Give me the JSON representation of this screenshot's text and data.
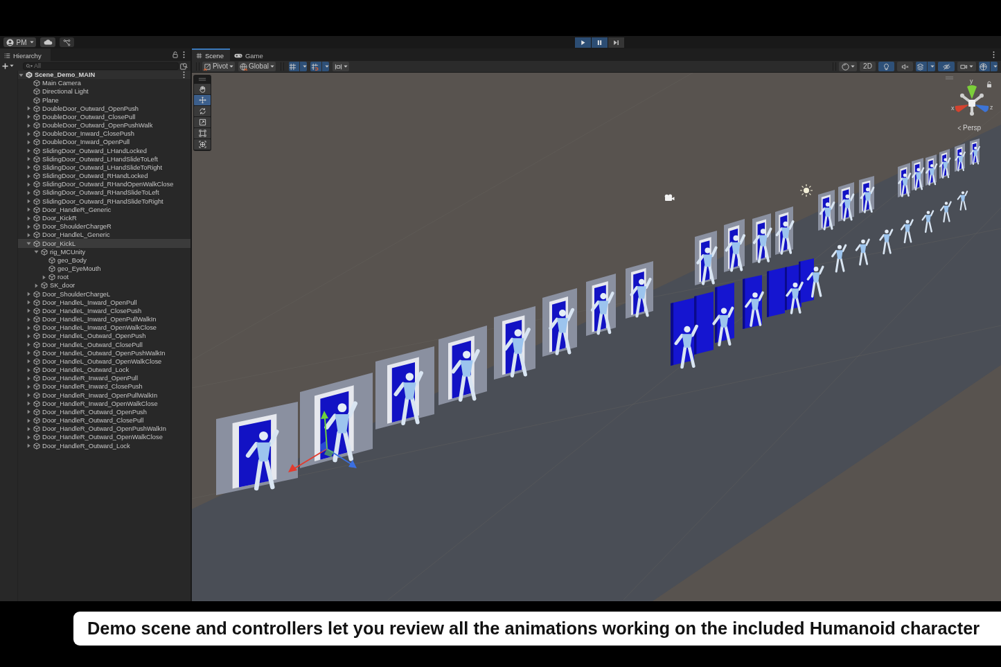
{
  "toolbar": {
    "account": {
      "label": "PM"
    },
    "play_controls": [
      {
        "kind": "play",
        "selected": true
      },
      {
        "kind": "pause",
        "selected": true
      },
      {
        "kind": "step",
        "selected": false
      }
    ]
  },
  "hierarchy": {
    "tab": {
      "label": "Hierarchy"
    },
    "search": {
      "placeholder": "All"
    },
    "scene": {
      "name": "Scene_Demo_MAIN",
      "expanded": true,
      "selected": false,
      "children": [
        {
          "name": "Main Camera",
          "selected": false
        },
        {
          "name": "Directional Light",
          "selected": false
        },
        {
          "name": "Plane",
          "selected": false
        },
        {
          "name": "DoubleDoor_Outward_OpenPush",
          "expanded": false,
          "selected": false
        },
        {
          "name": "DoubleDoor_Outward_ClosePull",
          "expanded": false,
          "selected": false
        },
        {
          "name": "DoubleDoor_Outward_OpenPushWalk",
          "expanded": false,
          "selected": false
        },
        {
          "name": "DoubleDoor_Inward_ClosePush",
          "expanded": false,
          "selected": false
        },
        {
          "name": "DoubleDoor_Inward_OpenPull",
          "expanded": false,
          "selected": false
        },
        {
          "name": "SlidingDoor_Outward_LHandLocked",
          "expanded": false,
          "selected": false
        },
        {
          "name": "SlidingDoor_Outward_LHandSlideToLeft",
          "expanded": false,
          "selected": false
        },
        {
          "name": "SlidingDoor_Outward_LHandSlideToRight",
          "expanded": false,
          "selected": false
        },
        {
          "name": "SlidingDoor_Outward_RHandLocked",
          "expanded": false,
          "selected": false
        },
        {
          "name": "SlidingDoor_Outward_RHandOpenWalkClose",
          "expanded": false,
          "selected": false
        },
        {
          "name": "SlidingDoor_Outward_RHandSlideToLeft",
          "expanded": false,
          "selected": false
        },
        {
          "name": "SlidingDoor_Outward_RHandSlideToRight",
          "expanded": false,
          "selected": false
        },
        {
          "name": "Door_HandleR_Generic",
          "expanded": false,
          "selected": false
        },
        {
          "name": "Door_KickR",
          "expanded": false,
          "selected": false
        },
        {
          "name": "Door_ShoulderChargeR",
          "expanded": false,
          "selected": false
        },
        {
          "name": "Door_HandleL_Generic",
          "expanded": false,
          "selected": false
        },
        {
          "name": "Door_KickL",
          "expanded": true,
          "selected": true,
          "children": [
            {
              "name": "rig_MCUnity",
              "expanded": true,
              "selected": false,
              "children": [
                {
                  "name": "geo_Body",
                  "selected": false
                },
                {
                  "name": "geo_EyeMouth",
                  "selected": false
                },
                {
                  "name": "root",
                  "expanded": false,
                  "selected": false
                }
              ]
            },
            {
              "name": "SK_door",
              "expanded": false,
              "selected": false
            }
          ]
        },
        {
          "name": "Door_ShoulderChargeL",
          "expanded": false,
          "selected": false
        },
        {
          "name": "Door_HandleL_Inward_OpenPull",
          "expanded": false,
          "selected": false
        },
        {
          "name": "Door_HandleL_Inward_ClosePush",
          "expanded": false,
          "selected": false
        },
        {
          "name": "Door_HandleL_Inward_OpenPullWalkIn",
          "expanded": false,
          "selected": false
        },
        {
          "name": "Door_HandleL_Inward_OpenWalkClose",
          "expanded": false,
          "selected": false
        },
        {
          "name": "Door_HandleL_Outward_OpenPush",
          "expanded": false,
          "selected": false
        },
        {
          "name": "Door_HandleL_Outward_ClosePull",
          "expanded": false,
          "selected": false
        },
        {
          "name": "Door_HandleL_Outward_OpenPushWalkIn",
          "expanded": false,
          "selected": false
        },
        {
          "name": "Door_HandleL_Outward_OpenWalkClose",
          "expanded": false,
          "selected": false
        },
        {
          "name": "Door_HandleL_Outward_Lock",
          "expanded": false,
          "selected": false
        },
        {
          "name": "Door_HandleR_Inward_OpenPull",
          "expanded": false,
          "selected": false
        },
        {
          "name": "Door_HandleR_Inward_ClosePush",
          "expanded": false,
          "selected": false
        },
        {
          "name": "Door_HandleR_Inward_OpenPullWalkIn",
          "expanded": false,
          "selected": false
        },
        {
          "name": "Door_HandleR_Inward_OpenWalkClose",
          "expanded": false,
          "selected": false
        },
        {
          "name": "Door_HandleR_Outward_OpenPush",
          "expanded": false,
          "selected": false
        },
        {
          "name": "Door_HandleR_Outward_ClosePull",
          "expanded": false,
          "selected": false
        },
        {
          "name": "Door_HandleR_Outward_OpenPushWalkIn",
          "expanded": false,
          "selected": false
        },
        {
          "name": "Door_HandleR_Outward_OpenWalkClose",
          "expanded": false,
          "selected": false
        },
        {
          "name": "Door_HandleR_Outward_Lock",
          "expanded": false,
          "selected": false
        }
      ]
    }
  },
  "scene_panel": {
    "tabs": [
      {
        "label": "Scene",
        "selected": true
      },
      {
        "label": "Game",
        "selected": false
      }
    ],
    "toolbar": {
      "handles": [
        {
          "kind": "pivot",
          "label": "Pivot"
        },
        {
          "kind": "global",
          "label": "Global"
        }
      ],
      "snapping": [
        {
          "kind": "grid",
          "selected": true
        },
        {
          "kind": "snap",
          "selected": true
        },
        {
          "kind": "align",
          "selected": false
        }
      ],
      "view_options": [
        {
          "kind": "shading",
          "selected": false
        },
        {
          "kind": "toggle2d",
          "label": "2D",
          "selected": false
        },
        {
          "kind": "lighting",
          "selected": true
        },
        {
          "kind": "audio",
          "selected": false
        },
        {
          "kind": "effects",
          "selected": true
        },
        {
          "kind": "visibility",
          "selected": true
        },
        {
          "kind": "camera",
          "selected": false
        },
        {
          "kind": "gizmos",
          "selected": true
        }
      ]
    },
    "tools": [
      {
        "kind": "hand",
        "selected": false
      },
      {
        "kind": "move",
        "selected": true
      },
      {
        "kind": "rotate",
        "selected": false
      },
      {
        "kind": "scale",
        "selected": false
      },
      {
        "kind": "rect",
        "selected": false
      },
      {
        "kind": "transform",
        "selected": false
      }
    ],
    "orientation_gizmo": {
      "axes": [
        {
          "label": "y",
          "color": "#7ccf3a"
        },
        {
          "label": "x",
          "color": "#d3432f"
        },
        {
          "label": "z",
          "color": "#3d74d6"
        }
      ],
      "projection": "Persp"
    }
  },
  "caption": {
    "text": "Demo scene and controllers let you review all the animations working on the included Humanoid character"
  }
}
